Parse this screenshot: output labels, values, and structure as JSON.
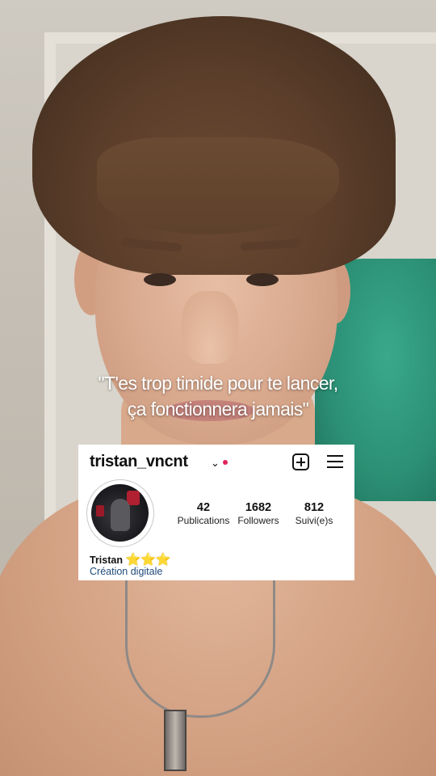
{
  "caption": {
    "line1": "\"T'es trop timide pour te lancer,",
    "line2": "ça fonctionnera jamais\""
  },
  "profile": {
    "username": "tristan_vncnt",
    "username_dropdown_icon": "chevron-down-icon",
    "notification_dot_color": "#e0245e",
    "header_icons": [
      "add-post-icon",
      "menu-icon"
    ],
    "stats": [
      {
        "value": "42",
        "label": "Publications"
      },
      {
        "value": "1682",
        "label": "Followers"
      },
      {
        "value": "812",
        "label": "Suivi(e)s"
      }
    ],
    "display_name": "Tristan",
    "display_name_emoji": "⭐⭐⭐",
    "category": "Création digitale",
    "category_color": "#1f4a7a"
  }
}
